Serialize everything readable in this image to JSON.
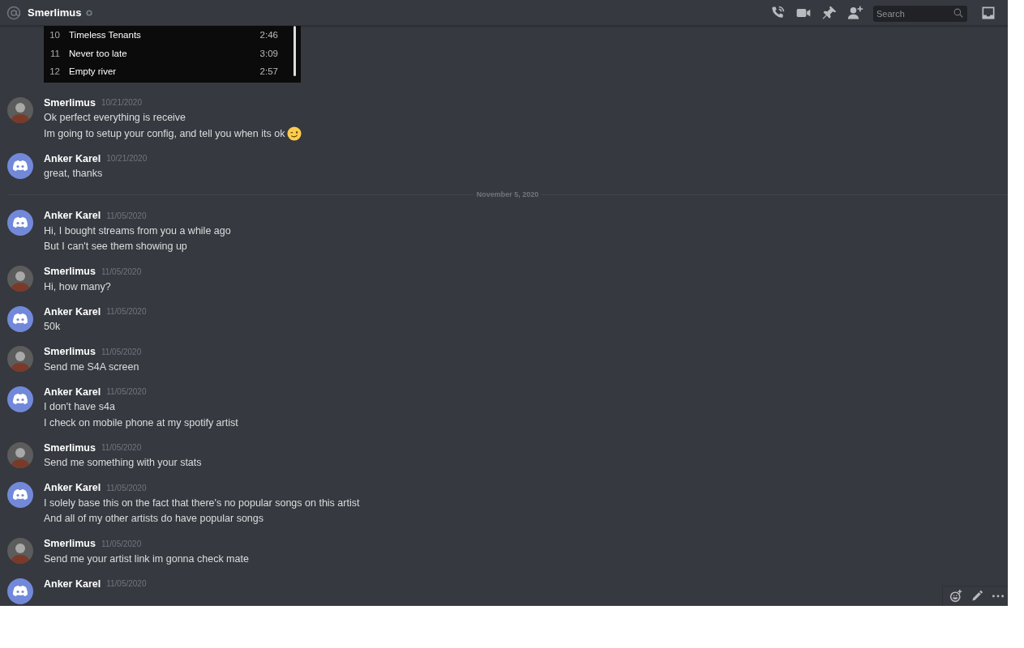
{
  "header": {
    "channel_name": "Smerlimus",
    "online": false,
    "search": {
      "placeholder": "Search"
    }
  },
  "embed": {
    "tracks": [
      {
        "number": "10",
        "title": "Timeless Tenants",
        "duration": "2:46"
      },
      {
        "number": "11",
        "title": "Never too late",
        "duration": "3:09"
      },
      {
        "number": "12",
        "title": "Empty river",
        "duration": "2:57"
      }
    ]
  },
  "messages": [
    {
      "kind": "message",
      "author": "Smerlimus",
      "photo_avatar": true,
      "timestamp": "10/21/2020",
      "lines": [
        "Ok perfect everything is receive",
        "Im going to setup your config, and tell you when its ok"
      ],
      "emoji": true
    },
    {
      "kind": "message",
      "author": "Anker Karel",
      "photo_avatar": false,
      "timestamp": "10/21/2020",
      "lines": [
        "great, thanks"
      ]
    },
    {
      "kind": "divider",
      "label": "November 5, 2020"
    },
    {
      "kind": "message",
      "author": "Anker Karel",
      "photo_avatar": false,
      "timestamp": "11/05/2020",
      "lines": [
        "Hi, I bought streams from you a while ago",
        "But I can't see them showing up"
      ]
    },
    {
      "kind": "message",
      "author": "Smerlimus",
      "photo_avatar": true,
      "timestamp": "11/05/2020",
      "lines": [
        "Hi, how many?"
      ]
    },
    {
      "kind": "message",
      "author": "Anker Karel",
      "photo_avatar": false,
      "timestamp": "11/05/2020",
      "lines": [
        "50k"
      ]
    },
    {
      "kind": "message",
      "author": "Smerlimus",
      "photo_avatar": true,
      "timestamp": "11/05/2020",
      "lines": [
        "Send me S4A screen"
      ]
    },
    {
      "kind": "message",
      "author": "Anker Karel",
      "photo_avatar": false,
      "timestamp": "11/05/2020",
      "lines": [
        "I don't have s4a",
        "I check on mobile phone at my spotify artist"
      ]
    },
    {
      "kind": "message",
      "author": "Smerlimus",
      "photo_avatar": true,
      "timestamp": "11/05/2020",
      "lines": [
        "Send me something with your stats"
      ]
    },
    {
      "kind": "message",
      "author": "Anker Karel",
      "photo_avatar": false,
      "timestamp": "11/05/2020",
      "lines": [
        "I solely base this on the fact that there's no popular songs on this artist",
        "And all of my other artists do have popular songs"
      ]
    },
    {
      "kind": "message",
      "author": "Smerlimus",
      "photo_avatar": true,
      "timestamp": "11/05/2020",
      "lines": [
        "Send me your artist link im gonna check mate"
      ]
    },
    {
      "kind": "message",
      "author": "Anker Karel",
      "photo_avatar": false,
      "timestamp": "11/05/2020"
    }
  ]
}
